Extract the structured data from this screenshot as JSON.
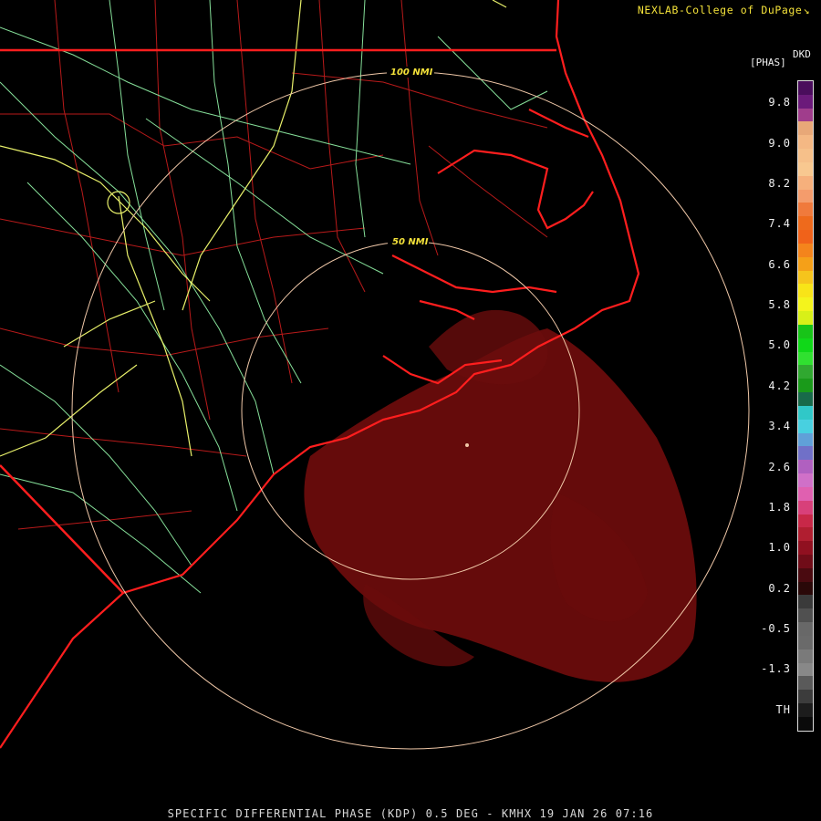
{
  "header": {
    "credit": "NEXLAB-College of DuPage",
    "credit_icon": "diagonal-arrow-icon"
  },
  "legend": {
    "product_code": "DKD",
    "unit": "[PHAS]",
    "ticks": [
      "9.8",
      "9.0",
      "8.2",
      "7.4",
      "6.6",
      "5.8",
      "5.0",
      "4.2",
      "3.4",
      "2.6",
      "1.8",
      "1.0",
      "0.2",
      "-0.5",
      "-1.3",
      "TH"
    ],
    "colors": [
      "#4a0d5c",
      "#6b1a7a",
      "#a03d8c",
      "#e8a878",
      "#f4b884",
      "#f6c08a",
      "#f8c890",
      "#f6b07c",
      "#f49c6c",
      "#f07a3c",
      "#ee6a1c",
      "#f0621a",
      "#f4841c",
      "#f5a018",
      "#f6c41c",
      "#f8e418",
      "#f4f41c",
      "#d8f018",
      "#18c418",
      "#10d818",
      "#30e030",
      "#30a830",
      "#1a9a1a",
      "#186a4a",
      "#30c8c8",
      "#48d0e0",
      "#60a0d8",
      "#7070c8",
      "#b060c0",
      "#d070c8",
      "#e060b0",
      "#d8407a",
      "#c82848",
      "#b01e30",
      "#901020",
      "#700c18",
      "#4a0a10",
      "#2a0808",
      "#3a3a3a",
      "#505050",
      "#686868",
      "#6a6a6a",
      "#7a7a7a",
      "#888888",
      "#5a5a5a",
      "#3c3c3c",
      "#1c1c1c",
      "#0a0a0a"
    ]
  },
  "map": {
    "range_rings": [
      "50 NMI",
      "100 NMI"
    ],
    "colors": {
      "coast": "#ff1e1e",
      "roads_primary": "#e8f06a",
      "roads_secondary": "#86e09a",
      "county": "#b81a1a",
      "ring": "#f0c8a8",
      "echo": "#6a0c0c"
    }
  },
  "footer": {
    "caption": "SPECIFIC DIFFERENTIAL PHASE (KDP) 0.5 DEG - KMHX 19 JAN 26 07:16"
  }
}
